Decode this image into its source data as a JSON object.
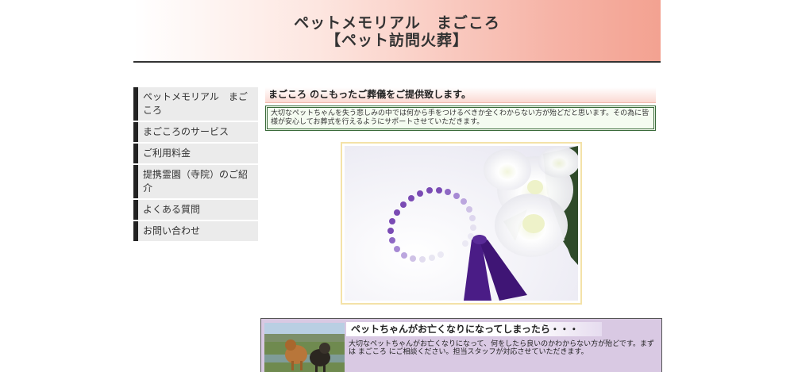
{
  "header": {
    "title_line1": "ペットメモリアル　まごころ",
    "title_line2": "【ペット訪問火葬】"
  },
  "sidebar": {
    "items": [
      {
        "label": "ペットメモリアル　まごころ"
      },
      {
        "label": "まごころのサービス"
      },
      {
        "label": "ご利用料金"
      },
      {
        "label": "提携霊園（寺院）のご紹介"
      },
      {
        "label": "よくある質問"
      },
      {
        "label": "お問い合わせ"
      }
    ]
  },
  "main": {
    "heading": "まごころ のこもったご葬儀をご提供致します。",
    "intro": "大切なペットちゃんを失う悲しみの中では何から手をつけるべきか全くわからない方が殆どだと思います。その為に皆様が安心してお葬式を行えるようにサポートさせていただきます。"
  },
  "passed": {
    "title": "ペットちゃんがお亡くなりになってしまったら・・・",
    "text": "大切なペットちゃんがお亡くなりになって、何をしたら良いのかわからない方が殆どです。まずは まごころ にご相談ください。担当スタッフが対応させていただきます。"
  },
  "colors": {
    "header_gradient_end": "#f3a291",
    "sidebar_accent": "#222222",
    "intro_border": "#3a6b3a",
    "section_bg": "#d9c9e3",
    "rosary": "#5a1f8c"
  },
  "icons": {
    "hero_image": "rosary-and-white-chrysanthemum-photo",
    "section_image": "dogs-at-riverside-photo"
  }
}
